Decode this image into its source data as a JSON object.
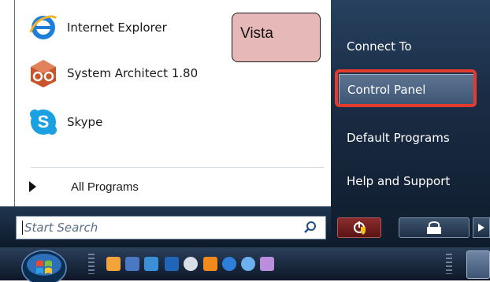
{
  "callout": {
    "label": "Vista"
  },
  "programs": [
    {
      "label": "Internet Explorer",
      "icon": "internet-explorer-icon"
    },
    {
      "label": "System Architect 1.80",
      "icon": "system-architect-icon"
    },
    {
      "label": "Skype",
      "icon": "skype-icon"
    }
  ],
  "all_programs": {
    "label": "All Programs"
  },
  "search": {
    "placeholder": "Start Search",
    "icon": "search-icon"
  },
  "right_pane": {
    "items": [
      {
        "label": "Connect To"
      },
      {
        "label": "Control Panel",
        "highlighted": true
      },
      {
        "label": "Default Programs"
      },
      {
        "label": "Help and Support"
      }
    ]
  },
  "power": {
    "icons": [
      "power-shield-icon",
      "lock-icon",
      "arrow-right-icon"
    ]
  },
  "colors": {
    "highlight": "#e33b2e",
    "callout_fill": "#e6b9b8",
    "pane_dark": "#1a2c44"
  },
  "taskbar": {
    "icons": [
      "windows-orb-icon",
      "app-icon-1",
      "show-desktop-icon",
      "switch-windows-icon",
      "app-icon-4",
      "app-icon-5",
      "app-icon-6",
      "internet-explorer-icon",
      "app-icon-8",
      "app-icon-9"
    ]
  }
}
